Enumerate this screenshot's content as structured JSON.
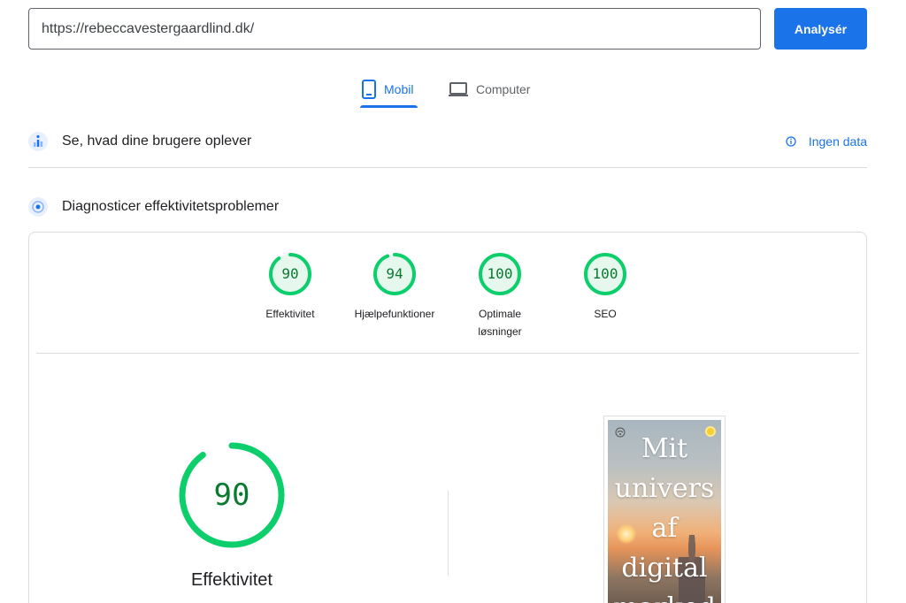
{
  "search": {
    "url_value": "https://rebeccavestergaardlind.dk/",
    "analyze_label": "Analysér"
  },
  "tabs": {
    "mobile_label": "Mobil",
    "computer_label": "Computer",
    "active": "Mobil"
  },
  "field_data": {
    "title": "Se, hvad dine brugere oplever",
    "no_data_label": "Ingen data"
  },
  "lab": {
    "title": "Diagnosticer effektivitetsproblemer",
    "scores": [
      {
        "value": "90",
        "label": "Effektivitet"
      },
      {
        "value": "94",
        "label": "Hjælpefunktioner"
      },
      {
        "value": "100",
        "label": "Optimale løsninger"
      },
      {
        "value": "100",
        "label": "SEO"
      }
    ],
    "main_score": {
      "value": "90",
      "label": "Effektivitet"
    }
  },
  "preview": {
    "text": "Mit\nunivers\naf\ndigital\nmarked"
  },
  "colors": {
    "accent": "#1a73e8",
    "score_good": "#0cce6b",
    "score_good_text": "#0a7a31"
  }
}
